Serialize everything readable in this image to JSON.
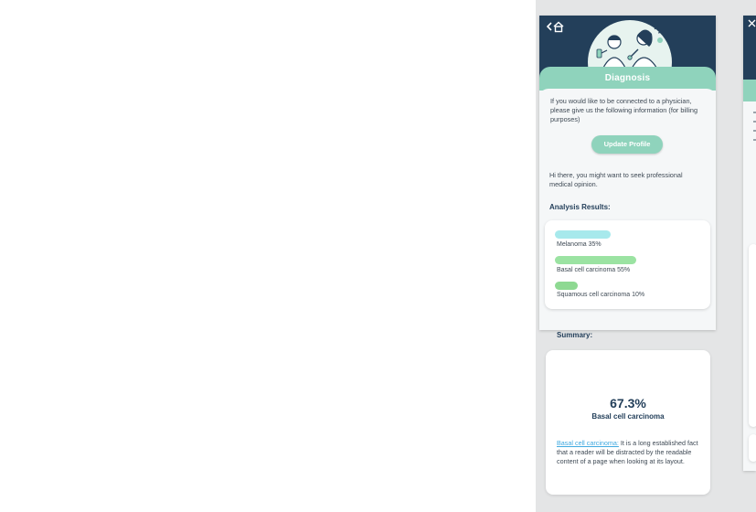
{
  "screen": {
    "title": "Diagnosis",
    "icons": [
      "back-icon",
      "home-icon",
      "doctors-illustration"
    ]
  },
  "intro_text": "If you would like to be connected to a physician, please give us the following information (for billing purposes)",
  "update_profile_label": "Update Profile",
  "advice_text": "Hi there, you might want to seek professional medical opinion.",
  "analysis": {
    "title": "Analysis Results:",
    "results": [
      {
        "label": "Melanoma 35%",
        "value": 35,
        "color": "#a7e9ec"
      },
      {
        "label": "Basal cell carcinoma 55%",
        "value": 55,
        "color": "#9be3a2"
      },
      {
        "label": "Squamous cell carcinoma 10%",
        "value": 10,
        "color": "#8ed992"
      }
    ]
  },
  "summary": {
    "label": "Summary:",
    "percent": "67.3%",
    "diagnosis": "Basal cell carcinoma",
    "link_text": "Basal cell carcinoma:",
    "description": " It is a long established fact that a reader will be distracted by the readable content of a page when looking at its layout."
  },
  "colors": {
    "navy": "#233f5a",
    "mint": "#8fd3bc",
    "link": "#3fa9e0",
    "panel_bg": "#e4e5e6"
  }
}
